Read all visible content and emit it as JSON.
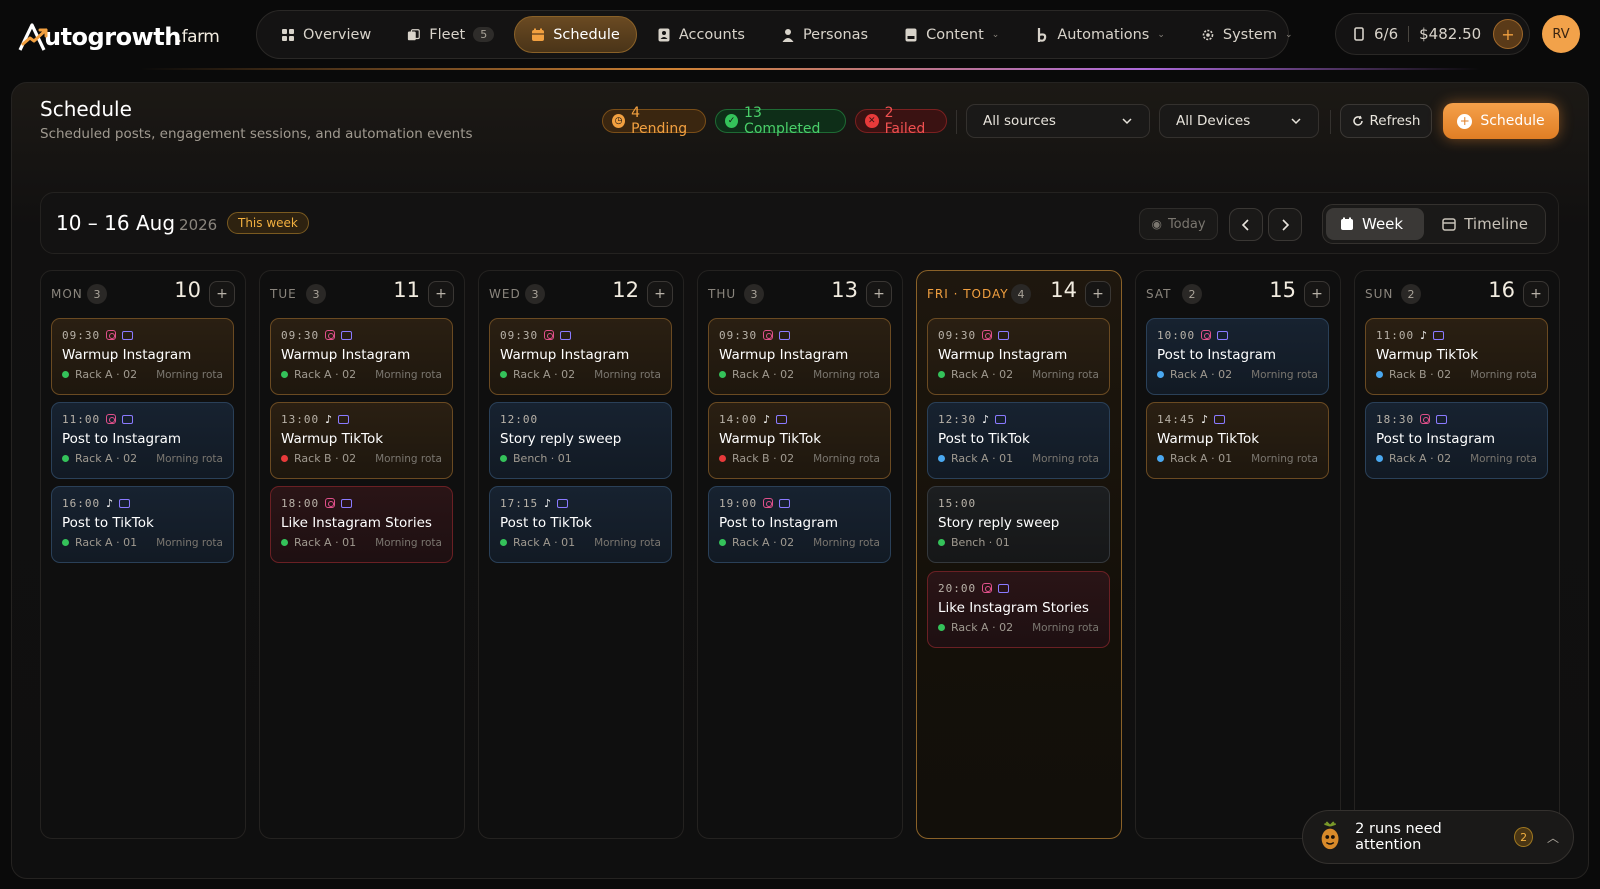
{
  "brand": {
    "name": "utogrowth",
    "tld": ".farm",
    "accent": "#f2a040"
  },
  "nav": [
    {
      "label": "Overview",
      "icon": "grid-icon"
    },
    {
      "label": "Fleet",
      "icon": "phone-stack-icon",
      "count": "5"
    },
    {
      "label": "Schedule",
      "icon": "calendar-icon",
      "active": true
    },
    {
      "label": "Accounts",
      "icon": "user-card-icon"
    },
    {
      "label": "Personas",
      "icon": "persona-icon"
    },
    {
      "label": "Content",
      "icon": "content-icon",
      "dropdown": true
    },
    {
      "label": "Automations",
      "icon": "automation-icon",
      "dropdown": true
    },
    {
      "label": "System",
      "icon": "gear-icon",
      "dropdown": true
    }
  ],
  "wallet": {
    "devices": "6/6",
    "balance": "$482.50",
    "add": "+"
  },
  "user": {
    "initials": "RV"
  },
  "page": {
    "title": "Schedule",
    "subtitle": "Scheduled posts, engagement sessions, and automation events"
  },
  "status": {
    "pending": "4 Pending",
    "completed": "13 Completed",
    "failed": "2 Failed"
  },
  "filters": {
    "sources": "All sources",
    "devices": "All Devices"
  },
  "actions": {
    "refresh": "Refresh",
    "schedule": "Schedule"
  },
  "week": {
    "range": "10 – 16 Aug",
    "year": "2026",
    "badge": "This week",
    "today_label": "Today",
    "views": [
      "Week",
      "Timeline"
    ],
    "active_view": "Week"
  },
  "days": [
    {
      "name": "MON",
      "count": "3",
      "num": "10",
      "events": [
        {
          "time": "09:30",
          "platform": "instagram",
          "title": "Warmup Instagram",
          "device": "Rack A · 02",
          "dot": "#34c25a",
          "rota": "Morning rota",
          "tone": "warm"
        },
        {
          "time": "11:00",
          "platform": "instagram",
          "title": "Post to Instagram",
          "device": "Rack A · 02",
          "dot": "#34c25a",
          "rota": "Morning rota",
          "tone": "cool"
        },
        {
          "time": "16:00",
          "platform": "tiktok",
          "title": "Post to TikTok",
          "device": "Rack A · 01",
          "dot": "#34c25a",
          "rota": "Morning rota",
          "tone": "cool"
        }
      ]
    },
    {
      "name": "TUE",
      "count": "3",
      "num": "11",
      "events": [
        {
          "time": "09:30",
          "platform": "instagram",
          "title": "Warmup Instagram",
          "device": "Rack A · 02",
          "dot": "#34c25a",
          "rota": "Morning rota",
          "tone": "warm"
        },
        {
          "time": "13:00",
          "platform": "tiktok",
          "title": "Warmup TikTok",
          "device": "Rack B · 02",
          "dot": "#e83a3a",
          "rota": "Morning rota",
          "tone": "warm"
        },
        {
          "time": "18:00",
          "platform": "instagram",
          "title": "Like Instagram Stories",
          "device": "Rack A · 01",
          "dot": "#34c25a",
          "rota": "Morning rota",
          "tone": "fail"
        }
      ]
    },
    {
      "name": "WED",
      "count": "3",
      "num": "12",
      "events": [
        {
          "time": "09:30",
          "platform": "instagram",
          "title": "Warmup Instagram",
          "device": "Rack A · 02",
          "dot": "#34c25a",
          "rota": "Morning rota",
          "tone": "warm"
        },
        {
          "time": "12:00",
          "platform": "",
          "title": "Story reply sweep",
          "device": "Bench · 01",
          "dot": "#34c25a",
          "rota": "",
          "tone": "cool"
        },
        {
          "time": "17:15",
          "platform": "tiktok",
          "title": "Post to TikTok",
          "device": "Rack A · 01",
          "dot": "#34c25a",
          "rota": "Morning rota",
          "tone": "cool"
        }
      ]
    },
    {
      "name": "THU",
      "count": "3",
      "num": "13",
      "events": [
        {
          "time": "09:30",
          "platform": "instagram",
          "title": "Warmup Instagram",
          "device": "Rack A · 02",
          "dot": "#34c25a",
          "rota": "Morning rota",
          "tone": "warm"
        },
        {
          "time": "14:00",
          "platform": "tiktok",
          "title": "Warmup TikTok",
          "device": "Rack B · 02",
          "dot": "#e83a3a",
          "rota": "Morning rota",
          "tone": "warm"
        },
        {
          "time": "19:00",
          "platform": "instagram",
          "title": "Post to Instagram",
          "device": "Rack A · 02",
          "dot": "#34c25a",
          "rota": "Morning rota",
          "tone": "cool"
        }
      ]
    },
    {
      "name": "FRI · TODAY",
      "count": "4",
      "num": "14",
      "today": true,
      "events": [
        {
          "time": "09:30",
          "platform": "instagram",
          "title": "Warmup Instagram",
          "device": "Rack A · 02",
          "dot": "#34c25a",
          "rota": "Morning rota",
          "tone": "warm"
        },
        {
          "time": "12:30",
          "platform": "tiktok",
          "title": "Post to TikTok",
          "device": "Rack A · 01",
          "dot": "#4aa8f0",
          "rota": "Morning rota",
          "tone": "cool"
        },
        {
          "time": "15:00",
          "platform": "",
          "title": "Story reply sweep",
          "device": "Bench · 01",
          "dot": "#34c25a",
          "rota": "",
          "tone": "neutral"
        },
        {
          "time": "20:00",
          "platform": "instagram",
          "title": "Like Instagram Stories",
          "device": "Rack A · 02",
          "dot": "#34c25a",
          "rota": "Morning rota",
          "tone": "fail"
        }
      ]
    },
    {
      "name": "SAT",
      "count": "2",
      "num": "15",
      "events": [
        {
          "time": "10:00",
          "platform": "instagram",
          "title": "Post to Instagram",
          "device": "Rack A · 02",
          "dot": "#4aa8f0",
          "rota": "Morning rota",
          "tone": "cool"
        },
        {
          "time": "14:45",
          "platform": "tiktok",
          "title": "Warmup TikTok",
          "device": "Rack A · 01",
          "dot": "#4aa8f0",
          "rota": "Morning rota",
          "tone": "warm"
        }
      ]
    },
    {
      "name": "SUN",
      "count": "2",
      "num": "16",
      "events": [
        {
          "time": "11:00",
          "platform": "tiktok",
          "title": "Warmup TikTok",
          "device": "Rack B · 02",
          "dot": "#4aa8f0",
          "rota": "Morning rota",
          "tone": "warm"
        },
        {
          "time": "18:30",
          "platform": "instagram",
          "title": "Post to Instagram",
          "device": "Rack A · 02",
          "dot": "#4aa8f0",
          "rota": "Morning rota",
          "tone": "cool"
        }
      ]
    }
  ],
  "attention": {
    "text": "2 runs need attention",
    "count": "2"
  }
}
